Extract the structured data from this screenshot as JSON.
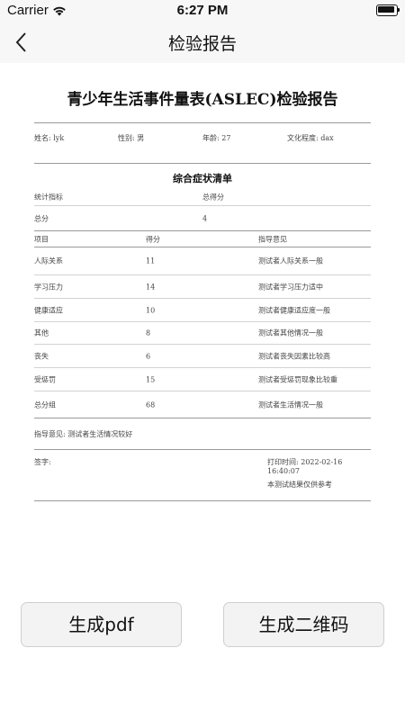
{
  "status_bar": {
    "carrier": "Carrier",
    "time": "6:27 PM"
  },
  "nav": {
    "title": "检验报告"
  },
  "report": {
    "title": "青少年生活事件量表(ASLEC)检验报告",
    "patient": {
      "name": "姓名: lyk",
      "gender": "性别: 男",
      "age": "年龄: 27",
      "education": "文化程度: dax"
    },
    "section_title": "综合症状清单",
    "summary_header": {
      "indicator": "统计指标",
      "total_label": "总得分"
    },
    "summary_row": {
      "label": "总分",
      "value": "4"
    },
    "table_header": {
      "item": "项目",
      "score": "得分",
      "advice": "指导意见"
    },
    "rows": [
      {
        "item": "人际关系",
        "score": "11",
        "advice": "测试者人际关系一般"
      },
      {
        "item": "学习压力",
        "score": "14",
        "advice": "测试者学习压力适中"
      },
      {
        "item": "健康适应",
        "score": "10",
        "advice": "测试者健康适应度一般"
      },
      {
        "item": "其他",
        "score": "8",
        "advice": "测试者其他情况一般"
      },
      {
        "item": "丧失",
        "score": "6",
        "advice": "测试者丧失因素比较高"
      },
      {
        "item": "受惩罚",
        "score": "15",
        "advice": "测试者受惩罚现象比较重"
      },
      {
        "item": "总分组",
        "score": "68",
        "advice": "测试者生活情况一般"
      }
    ],
    "overall_advice": "指导意见: 测试者生活情况较好",
    "signature_label": "签字:",
    "print_time": "打印时间: 2022-02-16 16:40:07",
    "disclaimer": "本测试结果仅供参考"
  },
  "buttons": {
    "generate_pdf": "生成pdf",
    "generate_qr": "生成二维码"
  }
}
